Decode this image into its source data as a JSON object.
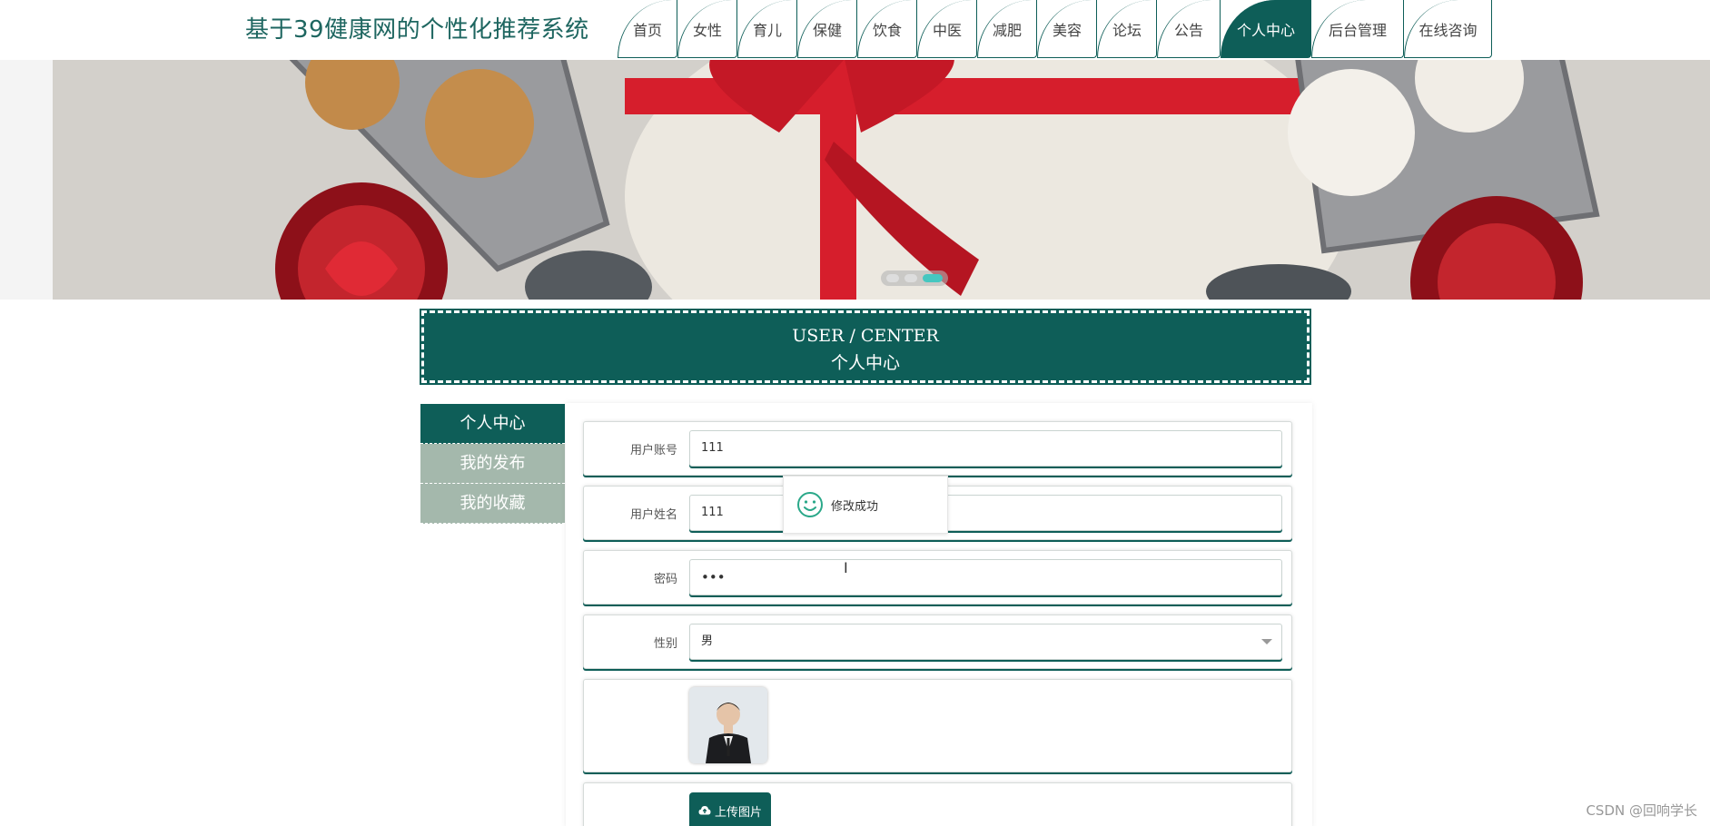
{
  "header": {
    "title": "基于39健康网的个性化推荐系统",
    "nav": [
      {
        "label": "首页",
        "active": false
      },
      {
        "label": "女性",
        "active": false
      },
      {
        "label": "育儿",
        "active": false
      },
      {
        "label": "保健",
        "active": false
      },
      {
        "label": "饮食",
        "active": false
      },
      {
        "label": "中医",
        "active": false
      },
      {
        "label": "减肥",
        "active": false
      },
      {
        "label": "美容",
        "active": false
      },
      {
        "label": "论坛",
        "active": false
      },
      {
        "label": "公告",
        "active": false
      },
      {
        "label": "个人中心",
        "active": true
      },
      {
        "label": "后台管理",
        "active": false
      },
      {
        "label": "在线咨询",
        "active": false
      }
    ]
  },
  "banner": {
    "slide_count": 3,
    "active_slide": 3
  },
  "center_title": {
    "en": "USER / CENTER",
    "cn": "个人中心"
  },
  "side_menu": [
    {
      "label": "个人中心",
      "active": true
    },
    {
      "label": "我的发布",
      "active": false
    },
    {
      "label": "我的收藏",
      "active": false
    }
  ],
  "form": {
    "account_label": "用户账号",
    "account_value": "111",
    "name_label": "用户姓名",
    "name_value": "111",
    "password_label": "密码",
    "password_value": "•••",
    "gender_label": "性别",
    "gender_value": "男",
    "upload_label": "上传图片"
  },
  "toast": {
    "message": "修改成功",
    "icon": "smiley-icon"
  },
  "watermark": "CSDN @回响学长",
  "colors": {
    "primary": "#0e5e58",
    "side_inactive": "#a4b8ac",
    "dot_active": "#45c7c0"
  }
}
